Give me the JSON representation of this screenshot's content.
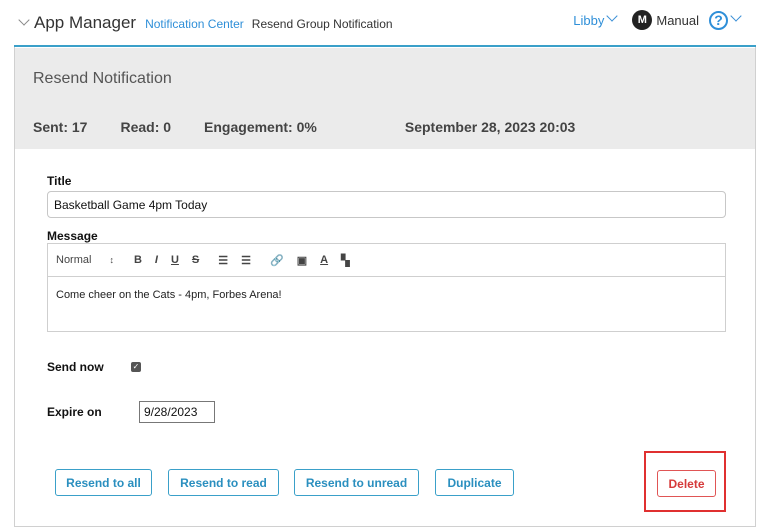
{
  "topbar": {
    "app_title": "App Manager",
    "breadcrumb_1": "Notification Center",
    "breadcrumb_2": "Resend Group Notification",
    "user_name": "Libby",
    "manual_label": "Manual",
    "help_symbol": "?"
  },
  "header": {
    "panel_title": "Resend Notification",
    "sent": "Sent: 17",
    "read": "Read: 0",
    "engagement": "Engagement: 0%",
    "date": "September 28, 2023 20:03"
  },
  "form": {
    "title_label": "Title",
    "title_value": "Basketball Game 4pm Today",
    "message_label": "Message",
    "toolbar": {
      "style_select": "Normal",
      "select_arrows": "↕",
      "bold": "B",
      "italic": "I",
      "underline": "U",
      "strike": "S",
      "ordered_list": "☰",
      "bullet_list": "☰",
      "link": "🔗",
      "image": "▣",
      "font_color": "A",
      "background": "▚"
    },
    "message_value": "Come cheer on the Cats - 4pm, Forbes Arena!",
    "send_now_label": "Send now",
    "send_now_checked": true,
    "expire_label": "Expire on",
    "expire_value": "9/28/2023"
  },
  "actions": {
    "resend_all": "Resend to all",
    "resend_read": "Resend to read",
    "resend_unread": "Resend to unread",
    "duplicate": "Duplicate",
    "delete": "Delete"
  },
  "colors": {
    "accent": "#2f8fd8",
    "border_accent": "#3aa0c9",
    "danger": "#d63a3a",
    "header_bg": "#ebebeb"
  }
}
